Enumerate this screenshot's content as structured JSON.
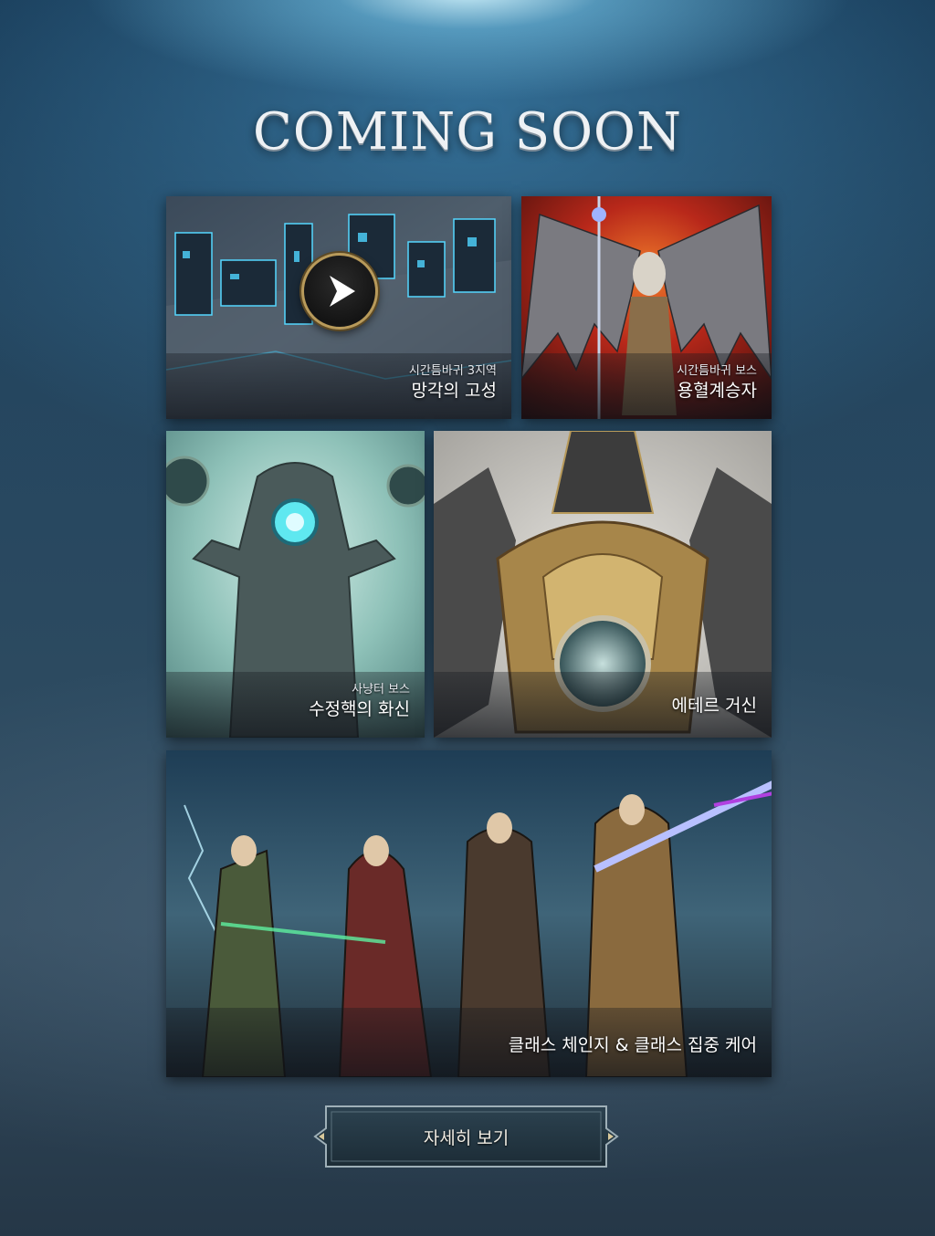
{
  "header": {
    "title": "COMING SOON"
  },
  "cards": [
    {
      "subtitle": "시간틈바귀 3지역",
      "title": "망각의 고성",
      "icon": "play-icon"
    },
    {
      "subtitle": "시간틈바귀 보스",
      "title": "용혈계승자"
    },
    {
      "subtitle": "사냥터 보스",
      "title": "수정핵의 화신"
    },
    {
      "subtitle": "",
      "title": "에테르 거신"
    },
    {
      "subtitle": "",
      "title": "클래스 체인지 & 클래스 집중 케어"
    }
  ],
  "cta": {
    "label": "자세히 보기"
  },
  "colors": {
    "accent_gold": "#b89a5a",
    "button_border": "#9fb0b8",
    "background": "#23455f"
  }
}
